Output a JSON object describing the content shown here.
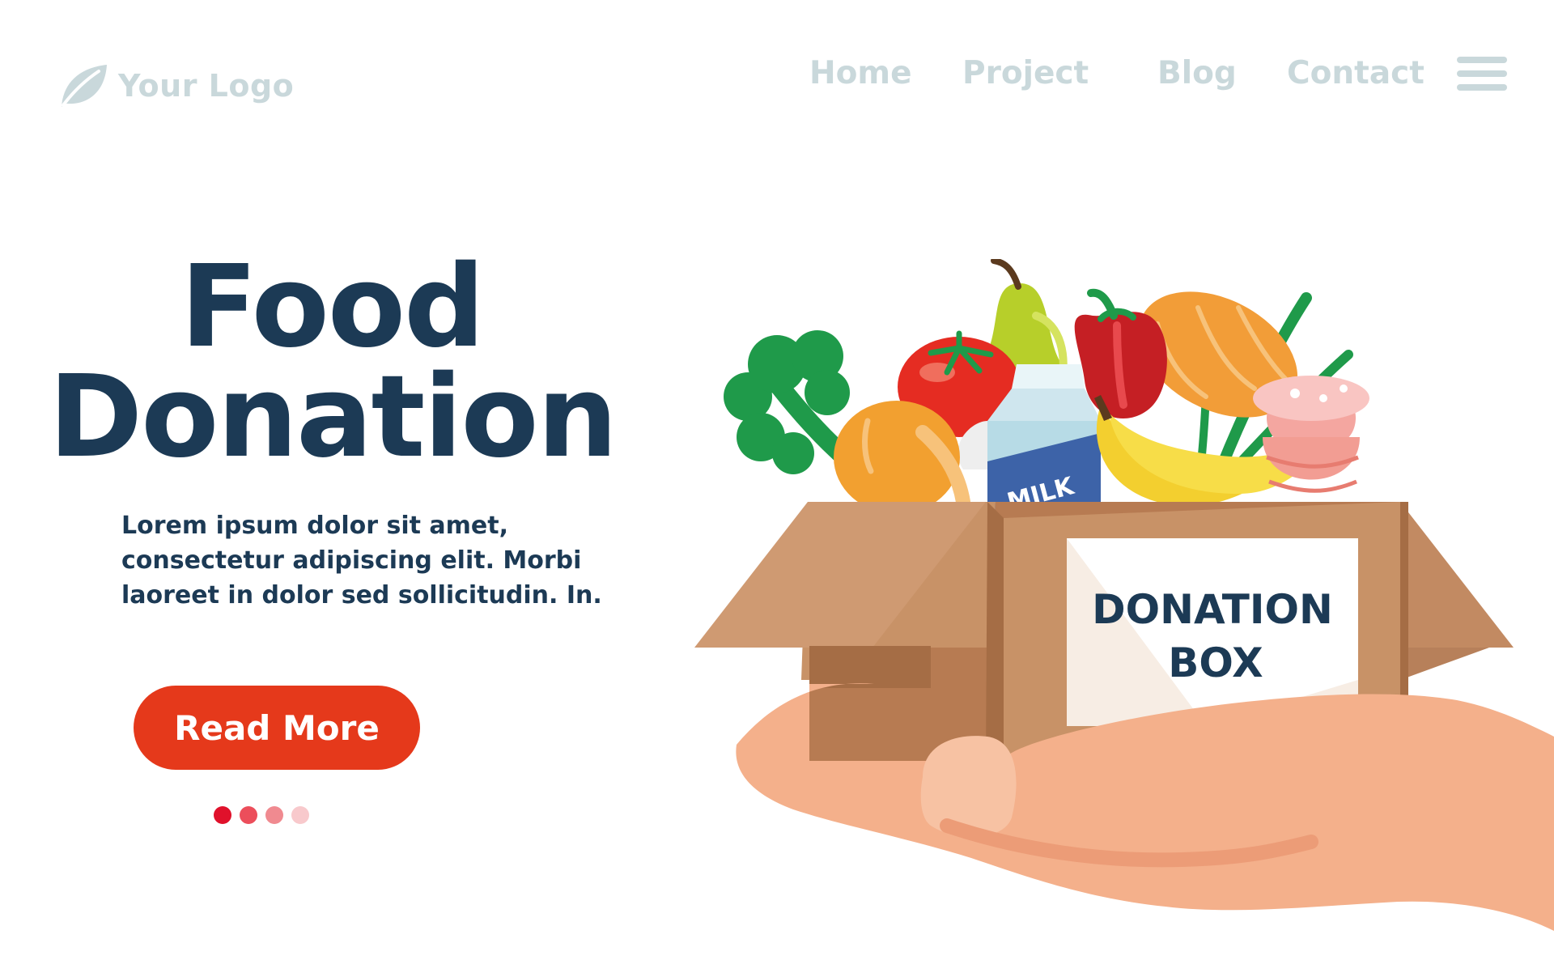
{
  "header": {
    "logo_text": "Your Logo",
    "nav": {
      "home": "Home",
      "project": "Project",
      "blog": "Blog",
      "contact": "Contact"
    }
  },
  "hero": {
    "title_line1": "Food",
    "title_line2": "Donation",
    "description": "Lorem ipsum dolor sit amet, consectetur adipiscing elit. Morbi laoreet in dolor sed sollicitudin. In.",
    "button_label": "Read More"
  },
  "illustration": {
    "box_label_line1": "DONATION",
    "box_label_line2": "BOX",
    "milk_label": "MILK"
  },
  "carousel": {
    "slide_count": 4,
    "active_index": 0
  },
  "colors": {
    "primary_dark": "#1c3a55",
    "accent_red": "#e5391b",
    "nav_muted": "#c9d8db",
    "dot_1": "#e0112b",
    "dot_2": "#ec4e5b",
    "dot_3": "#f08a90",
    "dot_4": "#f8c9cc"
  }
}
